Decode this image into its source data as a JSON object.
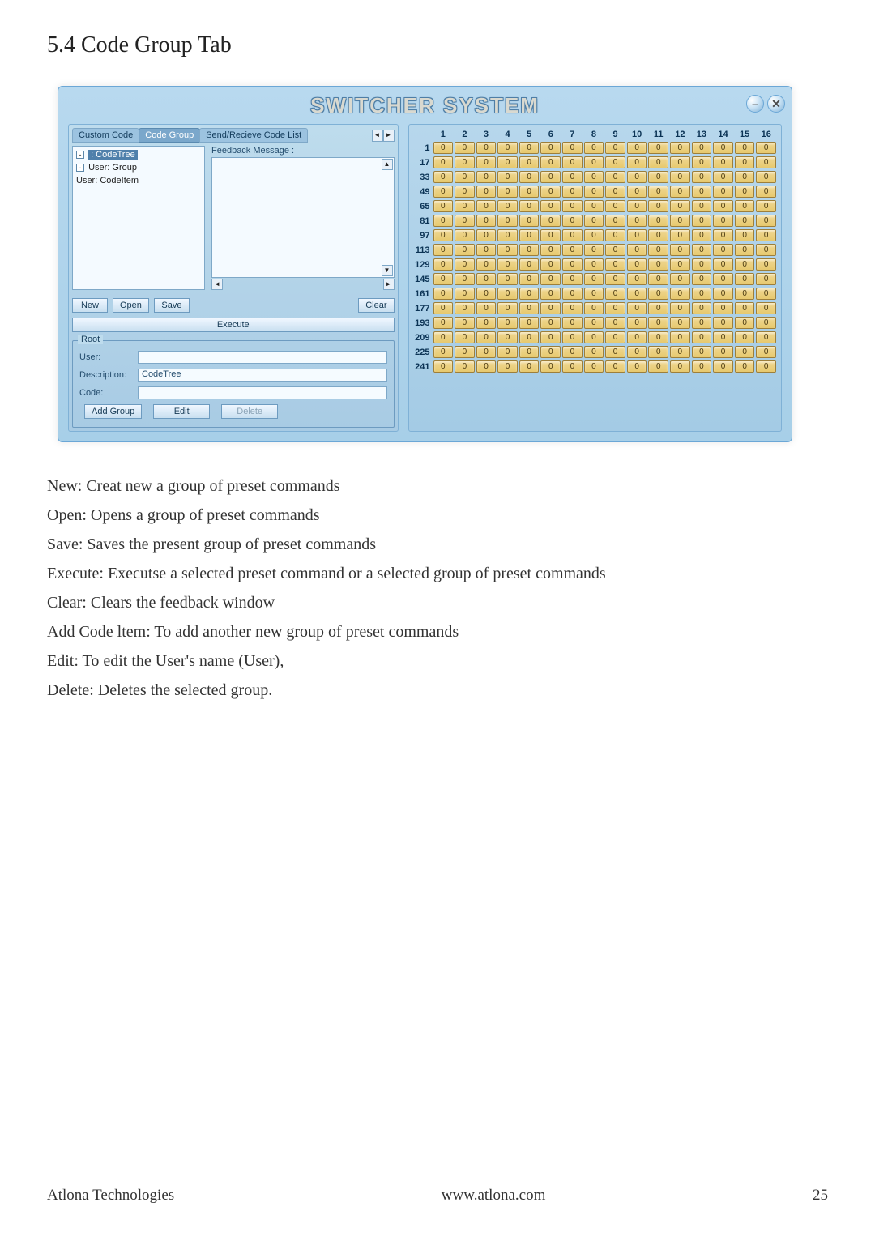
{
  "section_title": "5.4 Code Group Tab",
  "window": {
    "title": "SWITCHER SYSTEM",
    "min_glyph": "–",
    "close_glyph": "✕"
  },
  "left": {
    "tabs": [
      "Custom Code",
      "Code Group",
      "Send/Recieve Code List"
    ],
    "tabs_active_index": 1,
    "feedback_label": "Feedback Message :",
    "tree": {
      "root": ": CodeTree",
      "child": "User: Group",
      "grand": "User: CodeItem"
    },
    "btns": {
      "new": "New",
      "open": "Open",
      "save": "Save",
      "clear": "Clear",
      "execute": "Execute"
    },
    "root": {
      "legend": "Root",
      "labels": {
        "user": "User:",
        "desc": "Description:",
        "code": "Code:"
      },
      "values": {
        "user": "",
        "desc": "CodeTree",
        "code": ""
      },
      "btns": {
        "add": "Add Group",
        "edit": "Edit",
        "delete": "Delete"
      }
    }
  },
  "grid": {
    "columns": [
      "1",
      "2",
      "3",
      "4",
      "5",
      "6",
      "7",
      "8",
      "9",
      "10",
      "11",
      "12",
      "13",
      "14",
      "15",
      "16"
    ],
    "rows": [
      "1",
      "17",
      "33",
      "49",
      "65",
      "81",
      "97",
      "113",
      "129",
      "145",
      "161",
      "177",
      "193",
      "209",
      "225",
      "241"
    ],
    "cell_value": "0"
  },
  "definitions": [
    "New: Creat new a group of preset commands",
    "Open: Opens a group of preset commands",
    "Save: Saves the present group of preset commands",
    "Execute: Executse a selected preset command or a selected group of preset commands",
    "Clear: Clears the feedback window",
    "Add Code ltem: To add another new group of preset commands",
    "Edit: To edit the User's name (User),",
    "Delete: Deletes the selected group."
  ],
  "footer": {
    "left": "Atlona Technologies",
    "center": "www.atlona.com",
    "right": "25"
  }
}
